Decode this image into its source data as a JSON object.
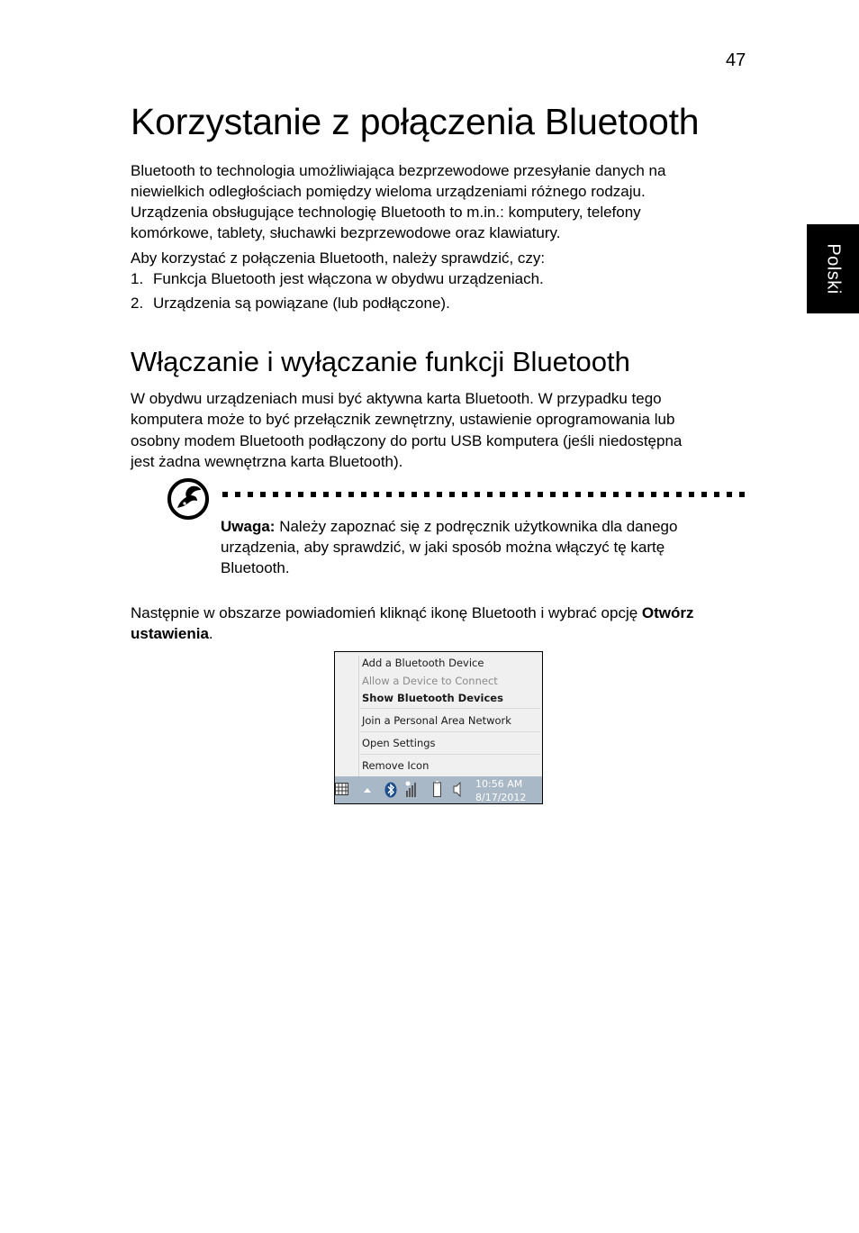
{
  "page": {
    "number": "47",
    "side_tab": "Polski"
  },
  "title": "Korzystanie z połączenia Bluetooth",
  "intro": {
    "lines": [
      "Bluetooth to technologia umożliwiająca bezprzewodowe przesyłanie danych na",
      "niewielkich odległościach pomiędzy wieloma urządzeniami różnego rodzaju.",
      "Urządzenia obsługujące technologię Bluetooth to m.in.: komputery, telefony",
      "komórkowe, tablety, słuchawki bezprzewodowe oraz klawiatury."
    ],
    "check_intro": "Aby korzystać z połączenia Bluetooth, należy sprawdzić, czy:",
    "list": [
      {
        "num": "1.",
        "text": "Funkcja Bluetooth jest włączona w obydwu urządzeniach."
      },
      {
        "num": "2.",
        "text": "Urządzenia są powiązane (lub podłączone)."
      }
    ]
  },
  "section": {
    "heading": "Włączanie i wyłączanie funkcji Bluetooth",
    "lines": [
      "W obydwu urządzeniach musi być aktywna karta Bluetooth. W przypadku tego",
      "komputera może to być przełącznik zewnętrzny, ustawienie oprogramowania lub",
      "osobny modem Bluetooth podłączony do portu USB komputera (jeśli niedostępna",
      "jest żadna wewnętrzna karta Bluetooth)."
    ]
  },
  "note": {
    "icon": "note-pen-icon",
    "label": "Uwaga:",
    "lines": [
      " Należy zapoznać się z podręcznik użytkownika dla danego",
      "urządzenia, aby sprawdzić, w jaki sposób można włączyć tę kartę",
      "Bluetooth."
    ]
  },
  "instruction": {
    "line1_pre": "Następnie w obszarze powiadomień kliknąć ikonę Bluetooth i wybrać opcję ",
    "line1_bold": "Otwórz",
    "line2_bold": "ustawienia",
    "line2_post": "."
  },
  "screenshot": {
    "menu_items": [
      {
        "label": "Add a Bluetooth Device",
        "state": "normal"
      },
      {
        "label": "Allow a Device to Connect",
        "state": "disabled"
      },
      {
        "label": "Show Bluetooth Devices",
        "state": "bold"
      },
      {
        "label": "Join a Personal Area Network",
        "state": "normal"
      },
      {
        "label": "Open Settings",
        "state": "normal"
      },
      {
        "label": "Remove Icon",
        "state": "normal"
      }
    ],
    "taskbar": {
      "icons": [
        "keyboard-icon",
        "show-hidden-icons-arrow",
        "bluetooth-icon",
        "network-signal-icon",
        "battery-icon",
        "speaker-icon"
      ],
      "time": "10:56 AM",
      "date": "8/17/2012",
      "bluetooth_color": "#1e4f8c"
    }
  }
}
